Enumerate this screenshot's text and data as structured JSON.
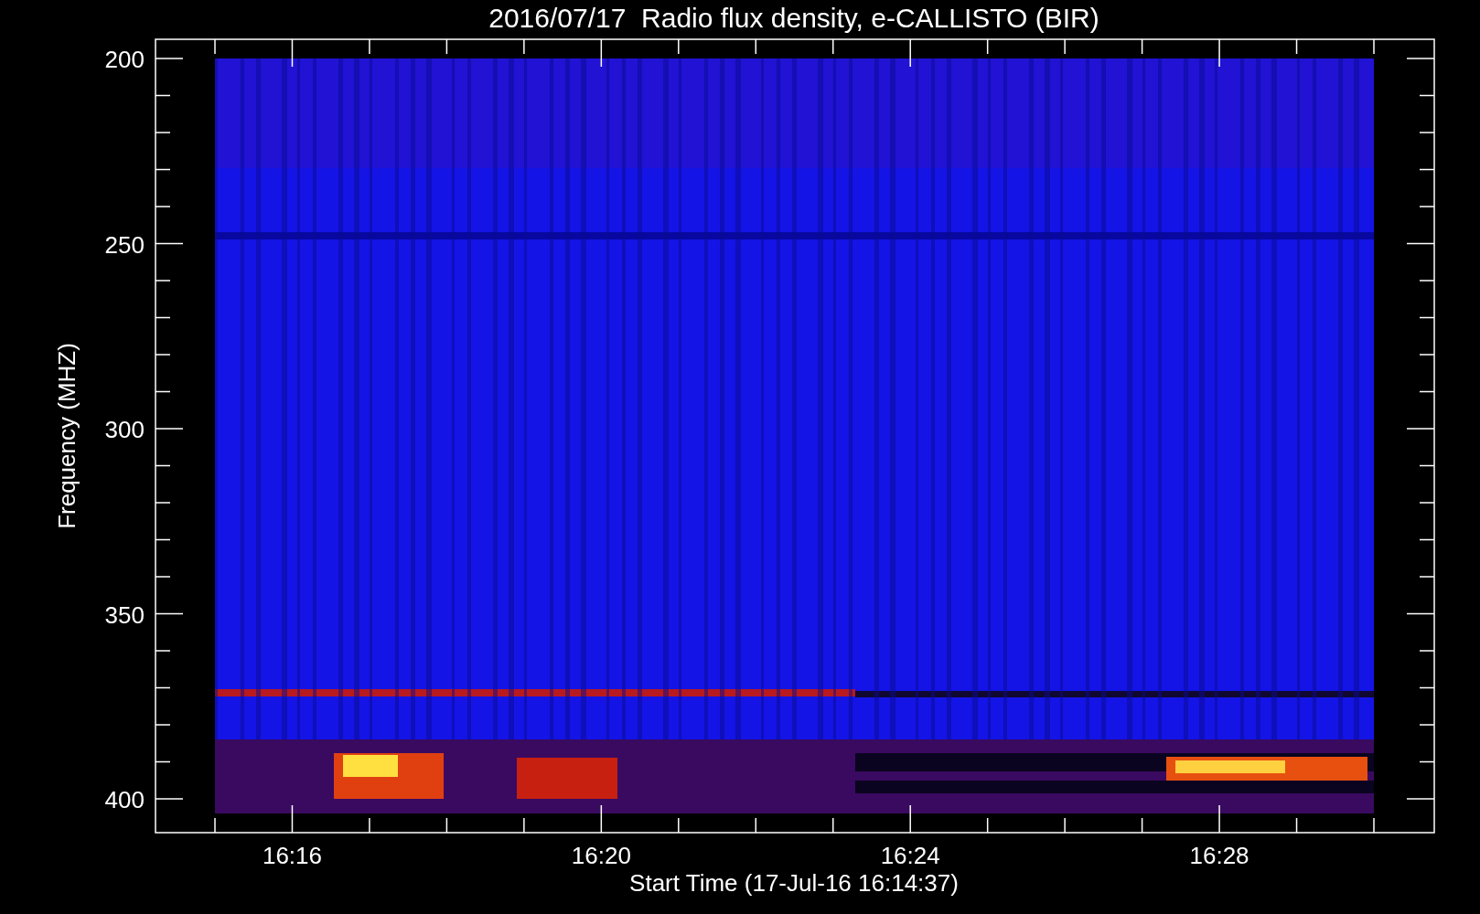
{
  "title": "2016/07/17  Radio flux density, e-CALLISTO (BIR)",
  "y_axis": {
    "label": "Frequency (MHZ)",
    "tick_labels": [
      "200",
      "250",
      "300",
      "350",
      "400"
    ]
  },
  "x_axis": {
    "label": "Start Time (17-Jul-16 16:14:37)",
    "tick_labels": [
      "16:16",
      "16:20",
      "16:24",
      "16:28"
    ]
  }
}
